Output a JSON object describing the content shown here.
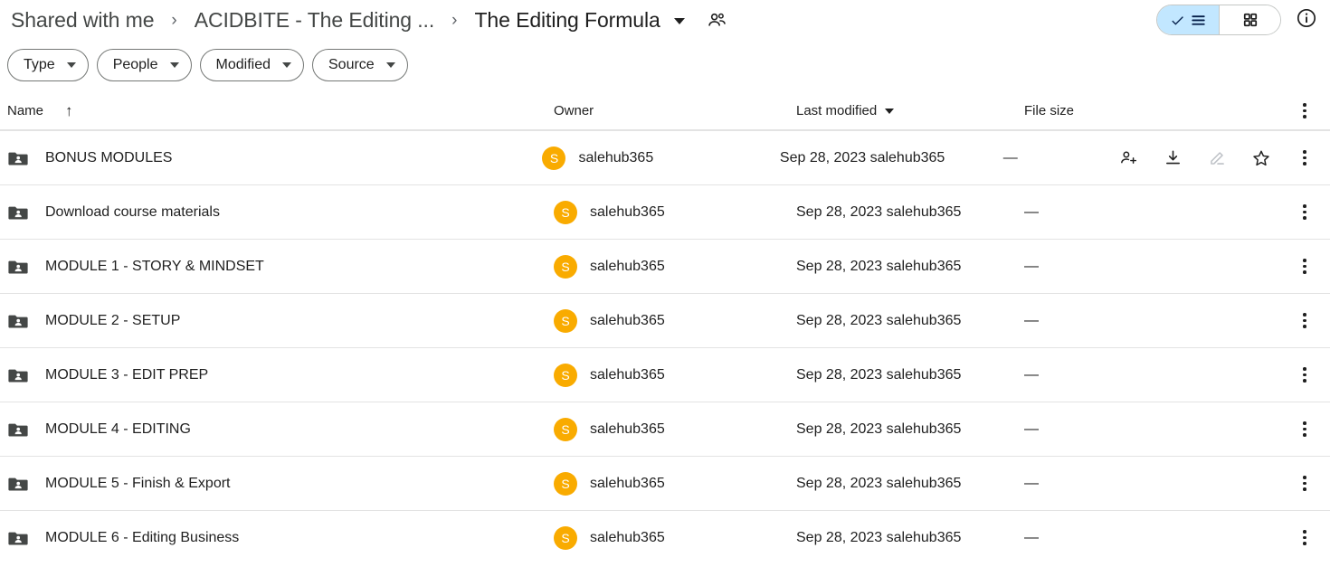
{
  "breadcrumb": {
    "items": [
      {
        "label": "Shared with me",
        "current": false
      },
      {
        "label": "ACIDBITE - The Editing ...",
        "current": false
      },
      {
        "label": "The Editing Formula",
        "current": true
      }
    ],
    "separator": "›",
    "dropdown_icon": "chevron-down-icon",
    "people_icon": "people-icon"
  },
  "header_actions": {
    "list_view_label": "list-view",
    "grid_view_label": "grid-view",
    "info_label": "details-info",
    "active_view": "list",
    "active_bg": "#c2e7ff"
  },
  "filters": [
    {
      "label": "Type"
    },
    {
      "label": "People"
    },
    {
      "label": "Modified"
    },
    {
      "label": "Source"
    }
  ],
  "columns": {
    "name": "Name",
    "owner": "Owner",
    "modified": "Last modified",
    "size": "File size",
    "sort_name_dir": "↑",
    "sort_modified_dir": "down"
  },
  "files": [
    {
      "name": "BONUS MODULES",
      "owner": "salehub365",
      "avatar_letter": "S",
      "modified": "Sep 28, 2023 salehub365",
      "size": "—",
      "hovered": true
    },
    {
      "name": "Download course materials",
      "owner": "salehub365",
      "avatar_letter": "S",
      "modified": "Sep 28, 2023 salehub365",
      "size": "—",
      "hovered": false
    },
    {
      "name": "MODULE 1 - STORY & MINDSET",
      "owner": "salehub365",
      "avatar_letter": "S",
      "modified": "Sep 28, 2023 salehub365",
      "size": "—",
      "hovered": false
    },
    {
      "name": "MODULE 2 - SETUP",
      "owner": "salehub365",
      "avatar_letter": "S",
      "modified": "Sep 28, 2023 salehub365",
      "size": "—",
      "hovered": false
    },
    {
      "name": "MODULE 3 - EDIT PREP",
      "owner": "salehub365",
      "avatar_letter": "S",
      "modified": "Sep 28, 2023 salehub365",
      "size": "—",
      "hovered": false
    },
    {
      "name": "MODULE 4 - EDITING",
      "owner": "salehub365",
      "avatar_letter": "S",
      "modified": "Sep 28, 2023 salehub365",
      "size": "—",
      "hovered": false
    },
    {
      "name": "MODULE 5 - Finish & Export",
      "owner": "salehub365",
      "avatar_letter": "S",
      "modified": "Sep 28, 2023 salehub365",
      "size": "—",
      "hovered": false
    },
    {
      "name": "MODULE 6 - Editing Business",
      "owner": "salehub365",
      "avatar_letter": "S",
      "modified": "Sep 28, 2023 salehub365",
      "size": "—",
      "hovered": false
    }
  ],
  "row_actions": {
    "share": "share-person-add",
    "download": "download",
    "edit": "edit-pencil",
    "star": "star",
    "more": "more-options",
    "edit_disabled_color": "#bdc1c6"
  },
  "colors": {
    "avatar_bg": "#f9ab00",
    "folder": "#444746",
    "divider": "#e3e3e3",
    "text": "#1f1f1f"
  }
}
